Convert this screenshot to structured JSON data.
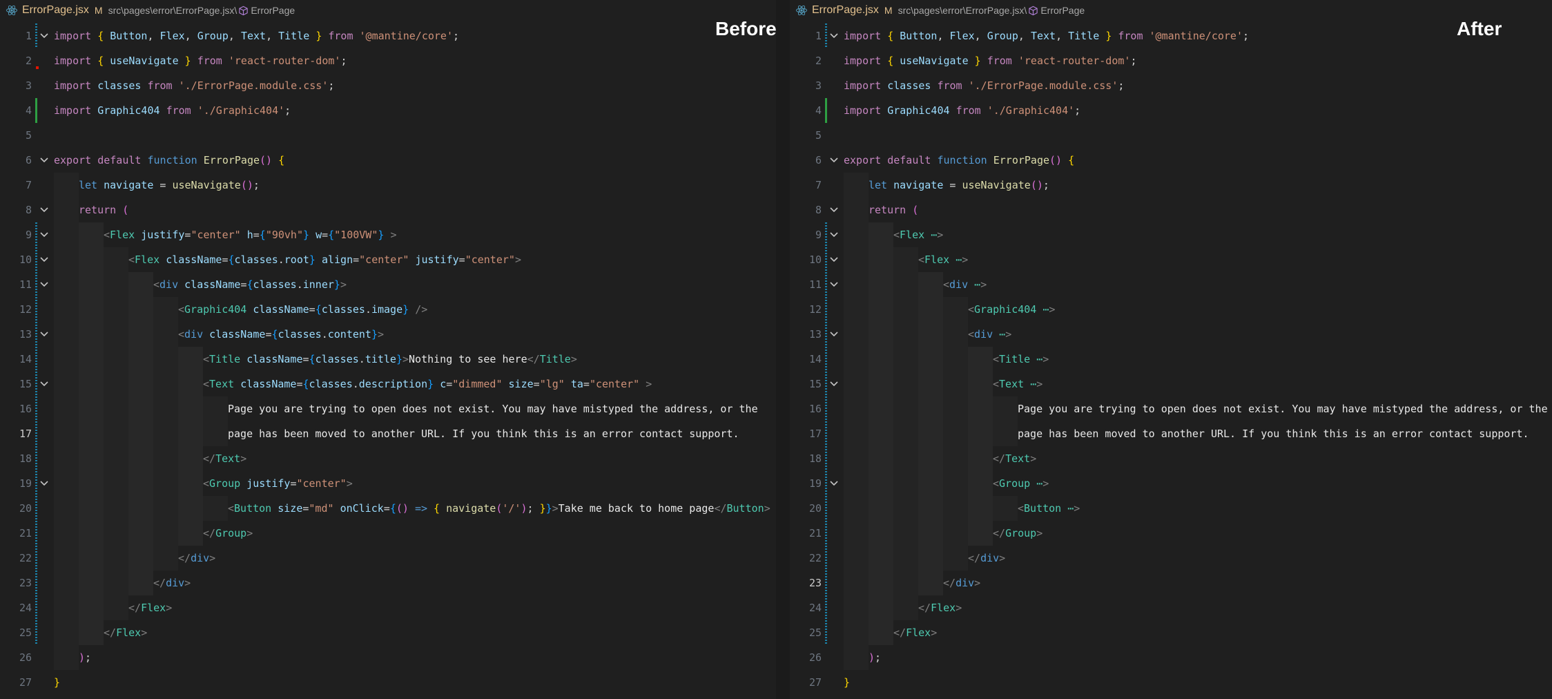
{
  "breadcrumb": {
    "file_name": "ErrorPage.jsx",
    "modified_badge": "M",
    "path": "src\\pages\\error\\ErrorPage.jsx\\",
    "symbol": "ErrorPage"
  },
  "panes": {
    "left": {
      "heading": "Before"
    },
    "right": {
      "heading": "After"
    }
  },
  "icons": [
    "react-icon",
    "symbol-cube-icon",
    "chevron-down-icon"
  ],
  "colors": {
    "background": "#1f1f1f",
    "modified_gutter": "#1b81a8",
    "added_gutter": "#2ea043",
    "keyword": "#c586c0",
    "string": "#ce9178",
    "tag": "#4ec9b0"
  },
  "line_numbers": [
    "1",
    "2",
    "3",
    "4",
    "5",
    "6",
    "7",
    "8",
    "9",
    "10",
    "11",
    "12",
    "13",
    "14",
    "15",
    "16",
    "17",
    "18",
    "19",
    "20",
    "21",
    "22",
    "23",
    "24",
    "25",
    "26",
    "27"
  ],
  "code": {
    "import_kw": "import",
    "from_kw": "from",
    "export_kw": "export",
    "default_kw": "default",
    "function_kw": "function",
    "let_kw": "let",
    "return_kw": "return",
    "button_id": "Button",
    "flex_id": "Flex",
    "group_id": "Group",
    "text_id": "Text",
    "title_id": "Title",
    "mantine_str": "'@mantine/core'",
    "usenavigate_id": "useNavigate",
    "router_str": "'react-router-dom'",
    "classes_id": "classes",
    "css_str": "'./ErrorPage.module.css'",
    "graphic_id": "Graphic404",
    "graphic_str": "'./Graphic404'",
    "errorpage_fn": "ErrorPage",
    "navigate_id": "navigate",
    "div_tag": "div",
    "justify_attr": "justify",
    "center_str": "\"center\"",
    "h_attr": "h",
    "vh_str": "\"90vh\"",
    "w_attr": "w",
    "vw_str": "\"100VW\"",
    "classname_attr": "className",
    "root_prop": "root",
    "align_attr": "align",
    "inner_prop": "inner",
    "image_prop": "image",
    "content_prop": "content",
    "title_prop": "title",
    "title_text": "Nothing to see here",
    "description_prop": "description",
    "c_attr": "c",
    "dimmed_str": "\"dimmed\"",
    "size_attr": "size",
    "lg_str": "\"lg\"",
    "ta_attr": "ta",
    "para1": "Page you are trying to open does not exist. You may have mistyped the address, or the",
    "para2": "page has been moved to another URL. If you think this is an error contact support.",
    "md_str": "\"md\"",
    "onclick_attr": "onClick",
    "slash_str": "'/'",
    "button_text": "Take me back to home page",
    "ellipsis": "⋯"
  }
}
